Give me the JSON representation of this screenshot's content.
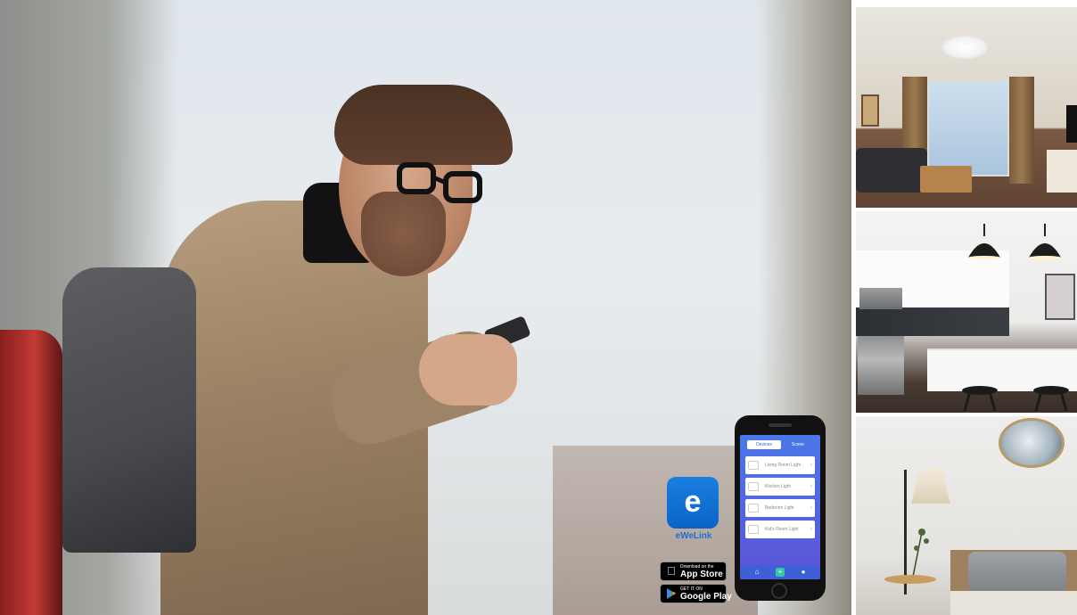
{
  "app": {
    "logo_letter": "e",
    "name": "eWeLink",
    "brand_color": "#1a7fe0"
  },
  "stores": {
    "apple": {
      "small": "Download on the",
      "big": "App Store",
      "icon": "apple-icon"
    },
    "google": {
      "small": "GET IT ON",
      "big": "Google Play",
      "icon": "google-play-icon"
    }
  },
  "phone_screen": {
    "tabs": [
      "Devices",
      "Scene"
    ],
    "devices": [
      {
        "label": "Living Room Light"
      },
      {
        "label": "Kitchen Light"
      },
      {
        "label": "Bedroom Light"
      },
      {
        "label": "Kid's Room Light"
      }
    ],
    "nav_icons": [
      "home-icon",
      "add-icon",
      "user-icon"
    ]
  },
  "scenes": [
    "living-room",
    "kitchen",
    "bedroom"
  ]
}
